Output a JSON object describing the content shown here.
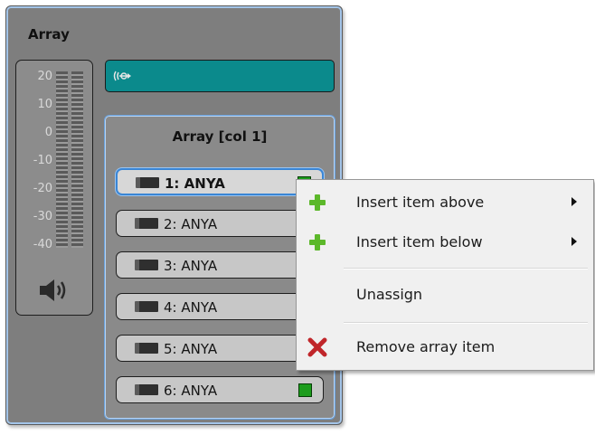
{
  "panel": {
    "title": "Array"
  },
  "meter": {
    "labels": [
      "20",
      "10",
      "0",
      "-10",
      "-20",
      "-30",
      "-40"
    ],
    "icon": "speaker-icon"
  },
  "teal_bar": {
    "icon": "network-link-icon",
    "color": "#0b8a8c"
  },
  "array_column": {
    "title": "Array [col 1]",
    "items": [
      {
        "label": "1: ANYA",
        "selected": true,
        "status_color": "#1c9c1c"
      },
      {
        "label": "2: ANYA"
      },
      {
        "label": "3: ANYA"
      },
      {
        "label": "4: ANYA"
      },
      {
        "label": "5: ANYA"
      },
      {
        "label": "6: ANYA",
        "status_color": "#1c9c1c"
      }
    ]
  },
  "context_menu": {
    "items": [
      {
        "label": "Insert item above",
        "icon": "plus-icon",
        "submenu": true
      },
      {
        "label": "Insert item below",
        "icon": "plus-icon",
        "submenu": true
      },
      {
        "label": "Unassign"
      },
      {
        "label": "Remove array item",
        "icon": "red-x-icon"
      }
    ],
    "plus_color": "#5cb82a",
    "remove_color": "#c0262a"
  }
}
